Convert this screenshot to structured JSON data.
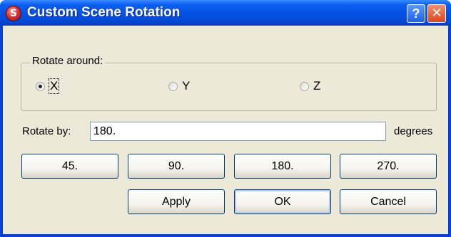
{
  "window": {
    "title": "Custom Scene Rotation",
    "icon": "app-logo-icon",
    "icon_glyph": "S",
    "help_label": "?",
    "close_label": "✕"
  },
  "rotate_around": {
    "label": "Rotate around:",
    "options": [
      {
        "label": "X",
        "checked": true
      },
      {
        "label": "Y",
        "checked": false
      },
      {
        "label": "Z",
        "checked": false
      }
    ]
  },
  "rotate_by": {
    "label": "Rotate by:",
    "value": "180.",
    "unit": "degrees"
  },
  "presets": [
    "45.",
    "90.",
    "180.",
    "270."
  ],
  "actions": {
    "apply": "Apply",
    "ok": "OK",
    "cancel": "Cancel"
  },
  "colors": {
    "titlebar": "#0553e6",
    "face": "#ece9d8",
    "close": "#d9461c"
  }
}
